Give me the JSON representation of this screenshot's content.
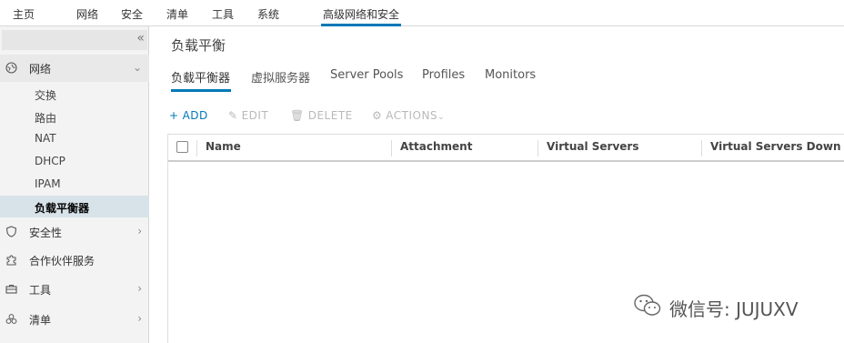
{
  "topnav": {
    "items": [
      "主页",
      "网络",
      "安全",
      "清单",
      "工具",
      "系统",
      "高级网络和安全"
    ]
  },
  "sidebar": {
    "collapse_glyph": "«",
    "groups": [
      {
        "label": "网络",
        "icon": "network-icon",
        "expanded": true
      },
      {
        "label": "安全性",
        "icon": "shield-icon"
      },
      {
        "label": "合作伙伴服务",
        "icon": "puzzle-icon"
      },
      {
        "label": "工具",
        "icon": "toolbox-icon"
      },
      {
        "label": "清单",
        "icon": "inventory-icon"
      }
    ],
    "network_items": [
      "交换",
      "路由",
      "NAT",
      "DHCP",
      "IPAM",
      "负载平衡器"
    ]
  },
  "main": {
    "title": "负载平衡",
    "tabs": [
      "负载平衡器",
      "虚拟服务器",
      "Server Pools",
      "Profiles",
      "Monitors"
    ],
    "toolbar": {
      "add": "ADD",
      "edit": "EDIT",
      "delete": "DELETE",
      "actions": "ACTIONS"
    },
    "columns": [
      "Name",
      "Attachment",
      "Virtual Servers",
      "Virtual Servers Down"
    ]
  },
  "watermark": {
    "text": "微信号: JUJUXV"
  },
  "colors": {
    "accent": "#0079b8",
    "active_sidebar_bg": "#d8e3e9",
    "sidebar_bg": "#f3f3f3",
    "disabled_text": "#b9b9b9"
  }
}
